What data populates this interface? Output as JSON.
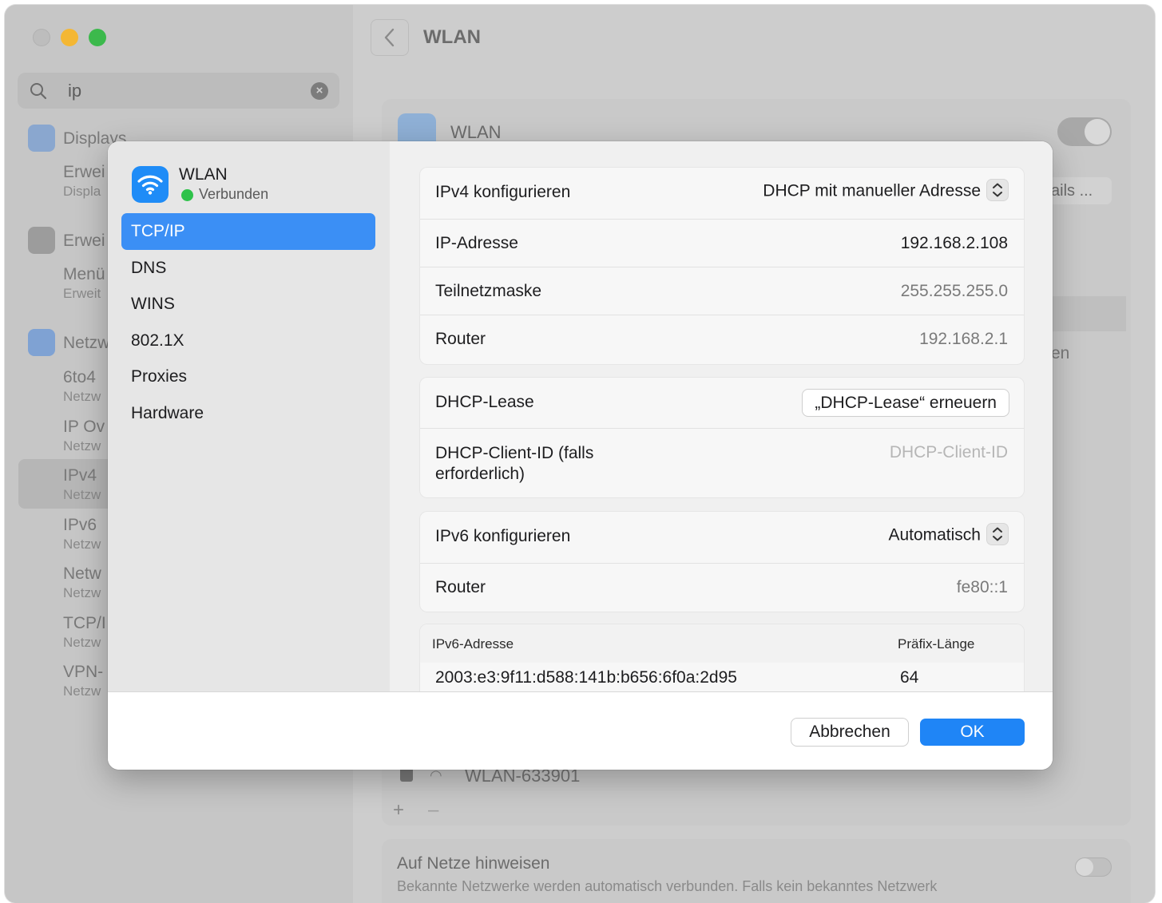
{
  "background": {
    "search_query": "ip",
    "sidebar": [
      {
        "title": "Displays",
        "subs": [
          "Erwei",
          "Displa"
        ]
      },
      {
        "title": "Erwei",
        "subs": [
          "Menü",
          "Erweit"
        ]
      },
      {
        "title": "Netzw",
        "subs": []
      },
      {
        "title": "6to4",
        "subs": [
          "Netzw"
        ]
      },
      {
        "title": "IP Ov",
        "subs": [
          "Netzw"
        ]
      },
      {
        "title": "IPv4",
        "subs": [
          "Netzw"
        ]
      },
      {
        "title": "IPv6",
        "subs": [
          "Netzw"
        ]
      },
      {
        "title": "Netw",
        "subs": [
          "Netzw"
        ]
      },
      {
        "title": "TCP/I",
        "subs": [
          "Netzw"
        ]
      },
      {
        "title": "VPN-",
        "subs": [
          "Netzw"
        ]
      }
    ],
    "header_title": "WLAN",
    "wlan_label": "WLAN",
    "details_button": "ails ...",
    "partial_text": "en",
    "network_name": "WLAN-633901",
    "hint_title": "Auf Netze hinweisen",
    "hint_subtitle": "Bekannte Netzwerke werden automatisch verbunden. Falls kein bekanntes Netzwerk"
  },
  "sheet": {
    "interface_name": "WLAN",
    "status": "Verbunden",
    "status_color": "#2ec24a",
    "nav": [
      "TCP/IP",
      "DNS",
      "WINS",
      "802.1X",
      "Proxies",
      "Hardware"
    ],
    "active_nav": "TCP/IP",
    "ipv4": {
      "configure_label": "IPv4 konfigurieren",
      "configure_value": "DHCP mit manueller Adresse",
      "ip_label": "IP-Adresse",
      "ip_value": "192.168.2.108",
      "subnet_label": "Teilnetzmaske",
      "subnet_value": "255.255.255.0",
      "router_label": "Router",
      "router_value": "192.168.2.1"
    },
    "dhcp": {
      "lease_label": "DHCP-Lease",
      "lease_button": "„DHCP-Lease“ erneuern",
      "client_id_label_line1": "DHCP-Client-ID (falls",
      "client_id_label_line2": "erforderlich)",
      "client_id_placeholder": "DHCP-Client-ID"
    },
    "ipv6": {
      "configure_label": "IPv6 konfigurieren",
      "configure_value": "Automatisch",
      "router_label": "Router",
      "router_value": "fe80::1",
      "table_header_address": "IPv6-Adresse",
      "table_header_prefix": "Präfix-Länge",
      "address": "2003:e3:9f11:d588:141b:b656:6f0a:2d95",
      "prefix": "64"
    },
    "cancel_label": "Abbrechen",
    "ok_label": "OK",
    "accent_color": "#1f85f6"
  }
}
